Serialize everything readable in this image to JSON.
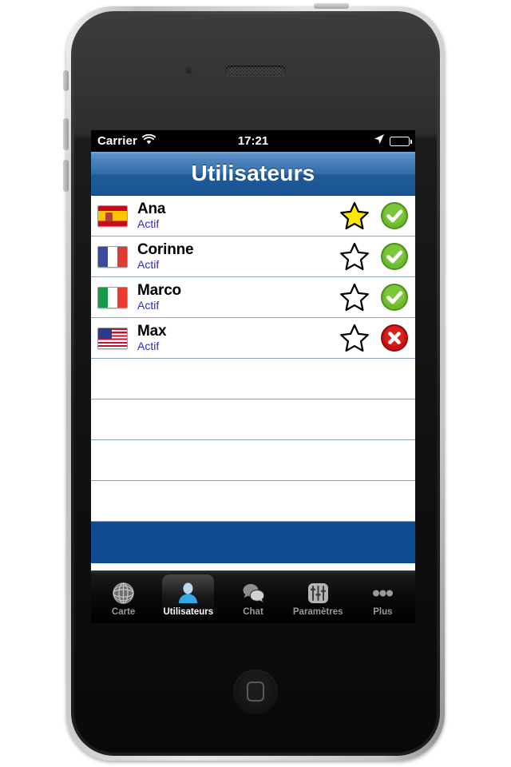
{
  "status_bar": {
    "carrier": "Carrier",
    "time": "17:21",
    "wifi_icon": "wifi-icon",
    "location_icon": "location-arrow-icon",
    "battery_icon": "battery-icon"
  },
  "nav_bar": {
    "title": "Utilisateurs"
  },
  "list": {
    "empty_row_count": 4,
    "rows": [
      {
        "name": "Ana",
        "status": "Actif",
        "flag": "flag-spain",
        "flag_class": "flag-es",
        "favorite": true,
        "favorite_icon": "star-filled-icon",
        "state": "ok",
        "state_icon": "check-circle-icon"
      },
      {
        "name": "Corinne",
        "status": "Actif",
        "flag": "flag-france",
        "flag_class": "flag-fr",
        "favorite": false,
        "favorite_icon": "star-outline-icon",
        "state": "ok",
        "state_icon": "check-circle-icon"
      },
      {
        "name": "Marco",
        "status": "Actif",
        "flag": "flag-italy",
        "flag_class": "flag-it",
        "favorite": false,
        "favorite_icon": "star-outline-icon",
        "state": "ok",
        "state_icon": "check-circle-icon"
      },
      {
        "name": "Max",
        "status": "Actif",
        "flag": "flag-united-states",
        "flag_class": "flag-us",
        "favorite": false,
        "favorite_icon": "star-outline-icon",
        "state": "error",
        "state_icon": "error-circle-icon"
      }
    ]
  },
  "tab_bar": {
    "items": [
      {
        "label": "Carte",
        "icon": "globe-icon",
        "selected": false
      },
      {
        "label": "Utilisateurs",
        "icon": "person-icon",
        "selected": true
      },
      {
        "label": "Chat",
        "icon": "chat-icon",
        "selected": false
      },
      {
        "label": "Paramètres",
        "icon": "sliders-icon",
        "selected": false
      },
      {
        "label": "Plus",
        "icon": "ellipsis-icon",
        "selected": false
      }
    ]
  },
  "colors": {
    "nav_bar_blue": "#1f5b99",
    "footer_blue": "#0f4b93",
    "status_text_blue": "#2a2acb",
    "star_fill": "#ffe800",
    "state_ok_green": "#6cba2d",
    "state_error_red": "#cc1111",
    "tab_selected_label": "#ffffff",
    "tab_label": "#9a9a9a"
  }
}
